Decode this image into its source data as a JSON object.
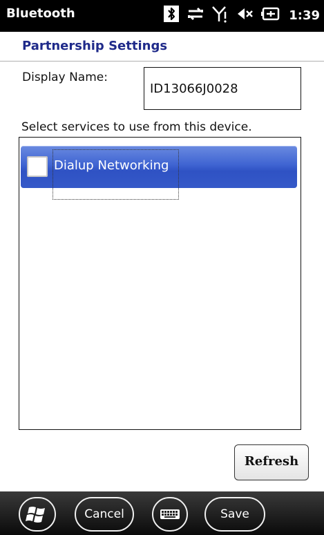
{
  "status_bar": {
    "title": "Bluetooth",
    "time": "1:39"
  },
  "header": {
    "title": "Partnership Settings"
  },
  "form": {
    "display_name_label": "Display Name:",
    "display_name_value": "ID13066J0028",
    "services_prompt": "Select services to use from this device."
  },
  "services": [
    {
      "label": "Dialup Networking",
      "checked": false,
      "selected": true
    }
  ],
  "buttons": {
    "refresh": "Refresh"
  },
  "toolbar": {
    "cancel": "Cancel",
    "save": "Save"
  },
  "colors": {
    "header_text": "#1f2a8a",
    "selection": "#3f64d2"
  }
}
